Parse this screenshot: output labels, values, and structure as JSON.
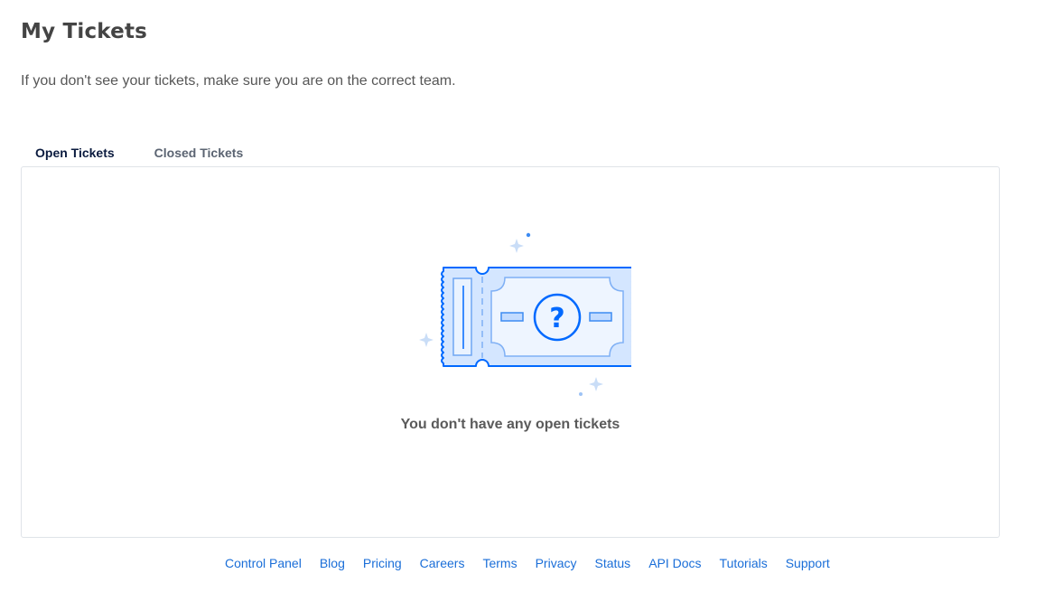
{
  "header": {
    "title": "My Tickets",
    "subtitle": "If you don't see your tickets, make sure you are on the correct team."
  },
  "tabs": [
    {
      "label": "Open Tickets",
      "active": true
    },
    {
      "label": "Closed Tickets",
      "active": false
    }
  ],
  "empty_state": {
    "icon": "ticket-question-icon",
    "message": "You don't have any open tickets"
  },
  "footer": {
    "links": [
      "Control Panel",
      "Blog",
      "Pricing",
      "Careers",
      "Terms",
      "Privacy",
      "Status",
      "API Docs",
      "Tutorials",
      "Support"
    ]
  },
  "colors": {
    "accent": "#0069ff",
    "ticket_fill": "#d4e6ff",
    "link": "#1a6ed8",
    "active_tab": "#0b1b3f"
  }
}
